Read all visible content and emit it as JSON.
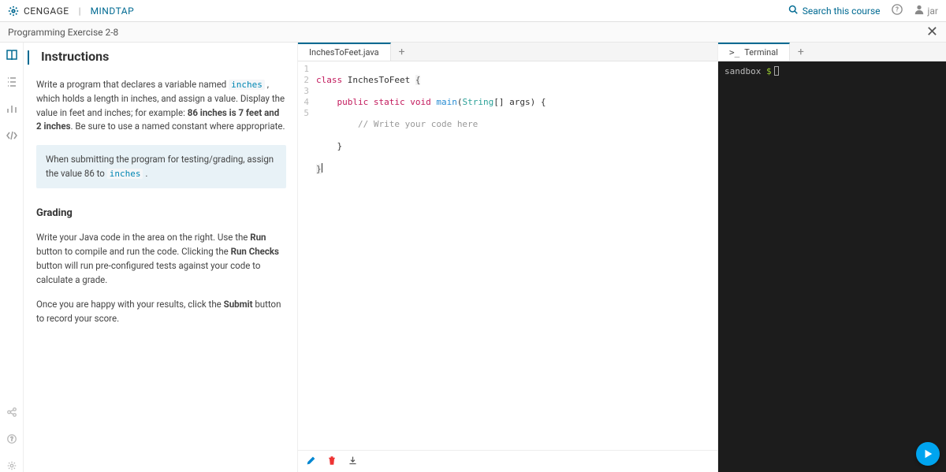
{
  "header": {
    "brand_main": "CENGAGE",
    "brand_sub": "MINDTAP",
    "search_placeholder": "Search this course",
    "username": "jar"
  },
  "subheader": {
    "title": "Programming Exercise 2-8"
  },
  "leftrail": {
    "items": [
      "book-icon",
      "list-icon",
      "chart-icon",
      "code-icon"
    ],
    "bottom": [
      "share-icon",
      "help-icon",
      "settings-icon"
    ]
  },
  "instructions": {
    "title": "Instructions",
    "p1a": "Write a program that declares a variable named ",
    "p1code": "inches",
    "p1b": " , which holds a length in inches, and assign a value. Display the value in feet and inches; for example: ",
    "p1bold": "86 inches is 7 feet and 2 inches",
    "p1c": ". Be sure to use a named constant where appropriate.",
    "note_a": "When submitting the program for testing/grading, assign the value 86 to ",
    "note_code": "inches",
    "note_b": " .",
    "grading_title": "Grading",
    "g1a": "Write your Java code in the area on the right. Use the ",
    "g1b1": "Run",
    "g1c": " button to compile and run the code. Clicking the ",
    "g1b2": "Run Checks",
    "g1d": " button will run pre-configured tests against your code to calculate a grade.",
    "g2a": "Once you are happy with your results, click the ",
    "g2b": "Submit",
    "g2c": " button to record your score."
  },
  "editor": {
    "tab_label": "InchesToFeet.java",
    "line_numbers": [
      "1",
      "2",
      "3",
      "4",
      "5"
    ],
    "l1": {
      "kw": "class",
      "name": "InchesToFeet",
      "br": "{"
    },
    "l2": {
      "ind": "    ",
      "kw1": "public",
      "kw2": "static",
      "kw3": "void",
      "meth": "main",
      "paren": "(",
      "type": "String",
      "arr": "[] ",
      "arg": "args",
      "pr": ")",
      "br": " {"
    },
    "l3": {
      "ind": "        ",
      "comm": "// Write your code here"
    },
    "l4": {
      "ind": "    ",
      "br": "}"
    },
    "l5": {
      "br": "}"
    }
  },
  "terminal": {
    "tab_label": "Terminal",
    "prompt_host": "sandbox",
    "prompt_sym": "$"
  }
}
